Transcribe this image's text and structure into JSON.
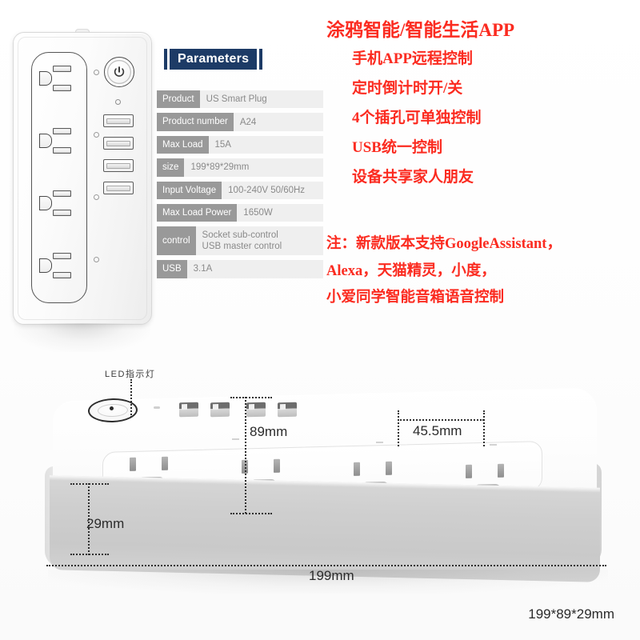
{
  "panel": {
    "header_title": "Parameters",
    "rows": [
      {
        "key": "Product",
        "value": "US Smart Plug"
      },
      {
        "key": "Product number",
        "value": "A24"
      },
      {
        "key": "Max Load",
        "value": "15A"
      },
      {
        "key": "size",
        "value": "199*89*29mm"
      },
      {
        "key": "Input Voltage",
        "value": "100-240V 50/60Hz"
      },
      {
        "key": "Max Load Power",
        "value": "1650W"
      },
      {
        "key": "control",
        "value": "Socket sub-control\nUSB master control"
      },
      {
        "key": "USB",
        "value": "3.1A"
      }
    ]
  },
  "marketing": {
    "title": "涂鸦智能/智能生活APP",
    "features": [
      "手机APP远程控制",
      "定时倒计时开/关",
      "4个插孔可单独控制",
      "USB统一控制",
      "设备共享家人朋友"
    ],
    "note_lines": [
      "注：新款版本支持GoogleAssistant，",
      "Alexa，天猫精灵，小度，",
      "小爱同学智能音箱语音控制"
    ],
    "accent_color": "#fb2b20",
    "header_color": "#1d3b66"
  },
  "hero": {
    "led_label": "LED指示灯",
    "dim_width": "199mm",
    "dim_depth": "89mm",
    "dim_height": "29mm",
    "dim_spacing": "45.5mm",
    "corner_size": "199*89*29mm"
  }
}
